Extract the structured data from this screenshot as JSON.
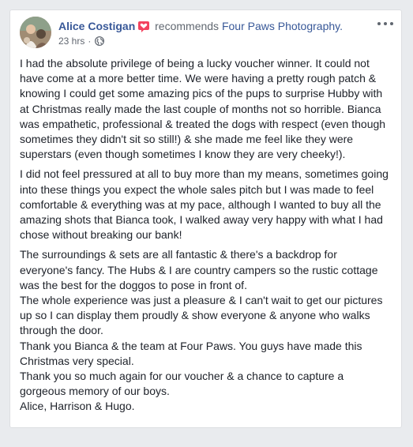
{
  "post": {
    "author": "Alice Costigan",
    "verb": "recommends",
    "page": "Four Paws Photography.",
    "timestamp": "23 hrs",
    "separator": "·",
    "icons": {
      "avatar": "profile-photo",
      "badge": "recommendation-badge-icon",
      "privacy": "globe-icon",
      "more": "more-options-icon"
    },
    "colors": {
      "link": "#385898",
      "badge": "#f3425f",
      "text": "#1d2129",
      "meta": "#616770"
    },
    "paragraphs": [
      "I had the absolute privilege of being a lucky voucher winner. It could not have come at a more better time. We were having a pretty rough patch & knowing I could get some amazing pics of the pups to surprise Hubby with at Christmas really made the last couple of months not so horrible. Bianca was empathetic, professional & treated the dogs with respect (even though sometimes they didn't sit so still!) & she made me feel like they were superstars (even though sometimes I know they are very cheeky!).",
      "I did not feel pressured at all to buy more than my means, sometimes going into these things you expect the whole sales pitch but I was made to feel comfortable & everything was at my pace, although I wanted to buy all the amazing shots that Bianca took, I walked away very happy with what I had chose without breaking our bank!",
      "The surroundings & sets are all fantastic & there's a backdrop for everyone's fancy. The Hubs & I are country campers so the rustic cottage was the best for the doggos to pose in front of.\nThe whole experience was just a pleasure & I can't wait to get our pictures up so I can display them proudly & show everyone & anyone who walks through the door.\nThank you Bianca & the team at Four Paws. You guys have made this Christmas very special.\nThank you so much again for our voucher & a chance to capture a gorgeous memory of our boys.\nAlice, Harrison & Hugo."
    ]
  }
}
